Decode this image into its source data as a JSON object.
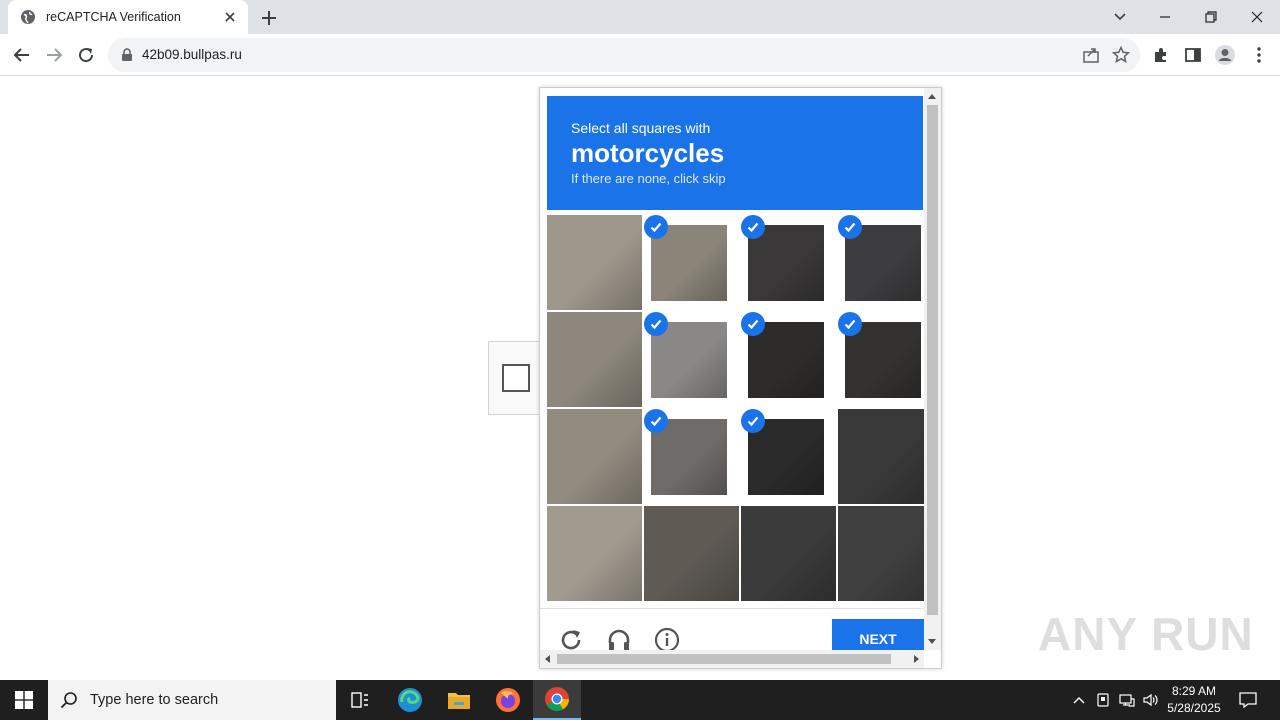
{
  "browser": {
    "tab_title": "reCAPTCHA Verification",
    "url": "42b09.bullpas.ru"
  },
  "captcha": {
    "instruction": "Select all squares with",
    "keyword": "motorcycles",
    "hint": "If there are none, click skip",
    "next_label": "NEXT",
    "tiles": [
      {
        "selected": false,
        "tone": "#9e978c"
      },
      {
        "selected": true,
        "tone": "#8a8479"
      },
      {
        "selected": true,
        "tone": "#3a3838"
      },
      {
        "selected": true,
        "tone": "#3d3d3f"
      },
      {
        "selected": false,
        "tone": "#8d877d"
      },
      {
        "selected": true,
        "tone": "#8a8886"
      },
      {
        "selected": true,
        "tone": "#2e2c2b"
      },
      {
        "selected": true,
        "tone": "#343230"
      },
      {
        "selected": false,
        "tone": "#928b80"
      },
      {
        "selected": true,
        "tone": "#6e6b69"
      },
      {
        "selected": true,
        "tone": "#2a2a2a"
      },
      {
        "selected": false,
        "tone": "#393939"
      },
      {
        "selected": false,
        "tone": "#a19a8f"
      },
      {
        "selected": false,
        "tone": "#5f5a54"
      },
      {
        "selected": false,
        "tone": "#3b3b3b"
      },
      {
        "selected": false,
        "tone": "#3f3f3f"
      }
    ]
  },
  "watermark": "ANY RUN",
  "taskbar": {
    "search_placeholder": "Type here to search",
    "time": "8:29 AM",
    "date": "5/28/2025"
  },
  "colors": {
    "accent": "#1a73e8"
  }
}
